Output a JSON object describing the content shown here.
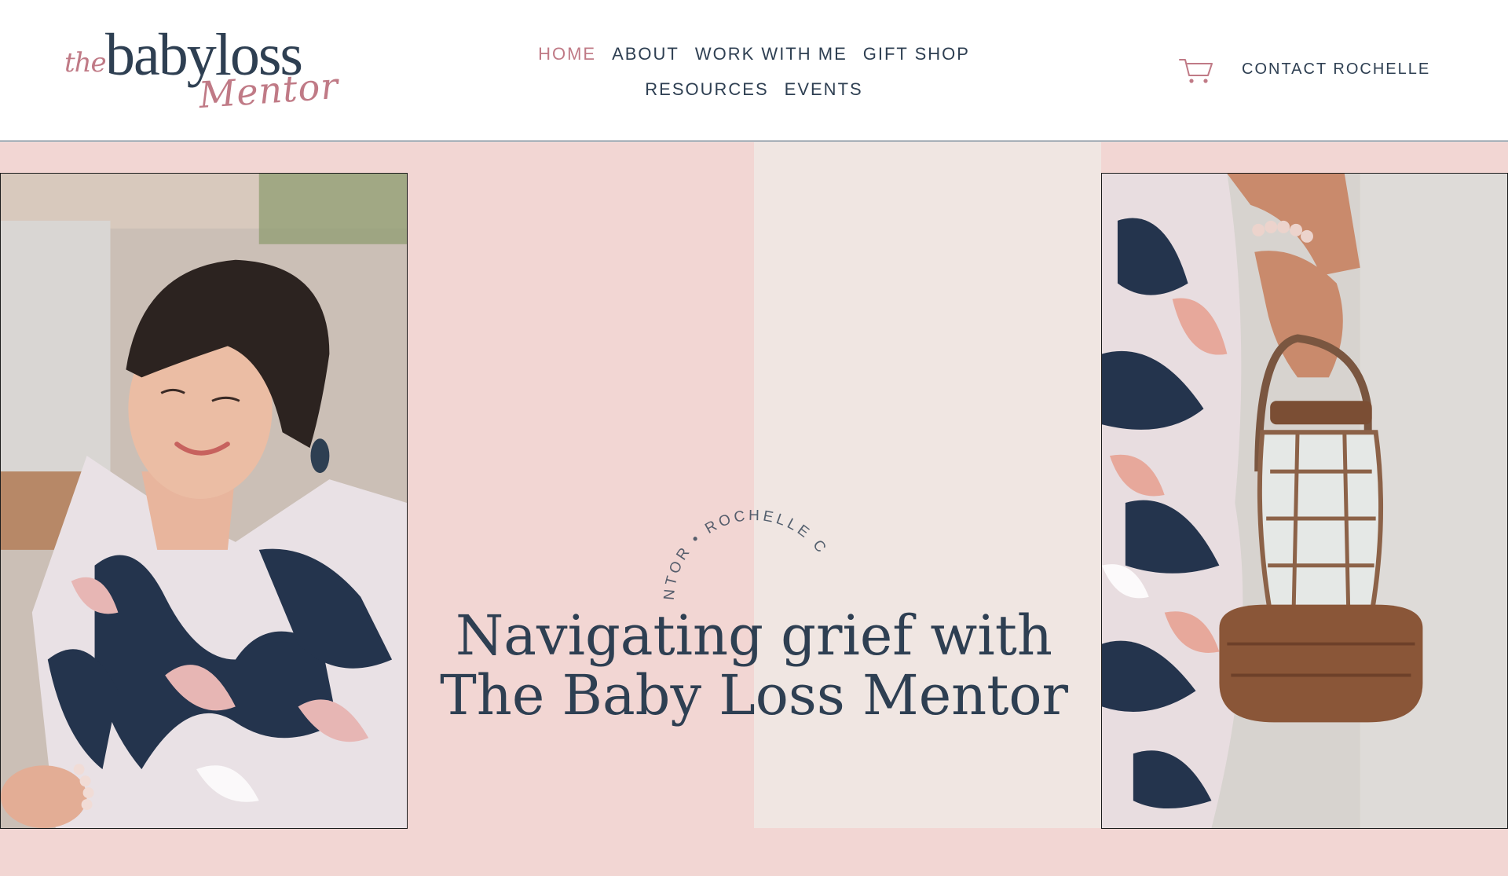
{
  "header": {
    "logo": {
      "the": "the",
      "babyloss": "babyloss",
      "mentor": "Mentor"
    },
    "nav": {
      "row1": [
        "HOME",
        "ABOUT",
        "WORK WITH ME",
        "GIFT SHOP"
      ],
      "row2": [
        "RESOURCES",
        "EVENTS"
      ],
      "active": "HOME"
    },
    "cart_icon": "shopping-cart-icon",
    "contact_label": "CONTACT ROCHELLE"
  },
  "hero": {
    "arc_text": "NTOR • ROCHELLE C",
    "headline_line1": "Navigating grief with",
    "headline_line2": "The Baby Loss Mentor",
    "left_photo": "portrait of smiling woman with short dark hair in floral dress",
    "right_photo": "hand holding a rusty vintage lantern against floral dress"
  },
  "colors": {
    "navy": "#2e3f52",
    "pink_accent": "#c07a86",
    "blush_background": "#f2d6d3",
    "beige_panel": "#f0e6e2"
  }
}
